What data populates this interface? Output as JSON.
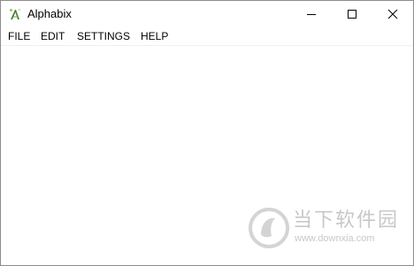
{
  "window": {
    "title": "Alphabix",
    "app_icon": "alphabix-app-icon"
  },
  "window_controls": {
    "minimize_icon": "minimize-icon",
    "maximize_icon": "maximize-icon",
    "close_icon": "close-icon"
  },
  "menu": {
    "items": [
      {
        "label": "FILE"
      },
      {
        "label": "EDIT"
      },
      {
        "label": "SETTINGS"
      },
      {
        "label": "HELP"
      }
    ]
  },
  "watermark": {
    "text": "当下软件园",
    "url": "www.downxia.com"
  },
  "colors": {
    "watermark": "#c8c8c8",
    "border": "#8c8c8c"
  }
}
